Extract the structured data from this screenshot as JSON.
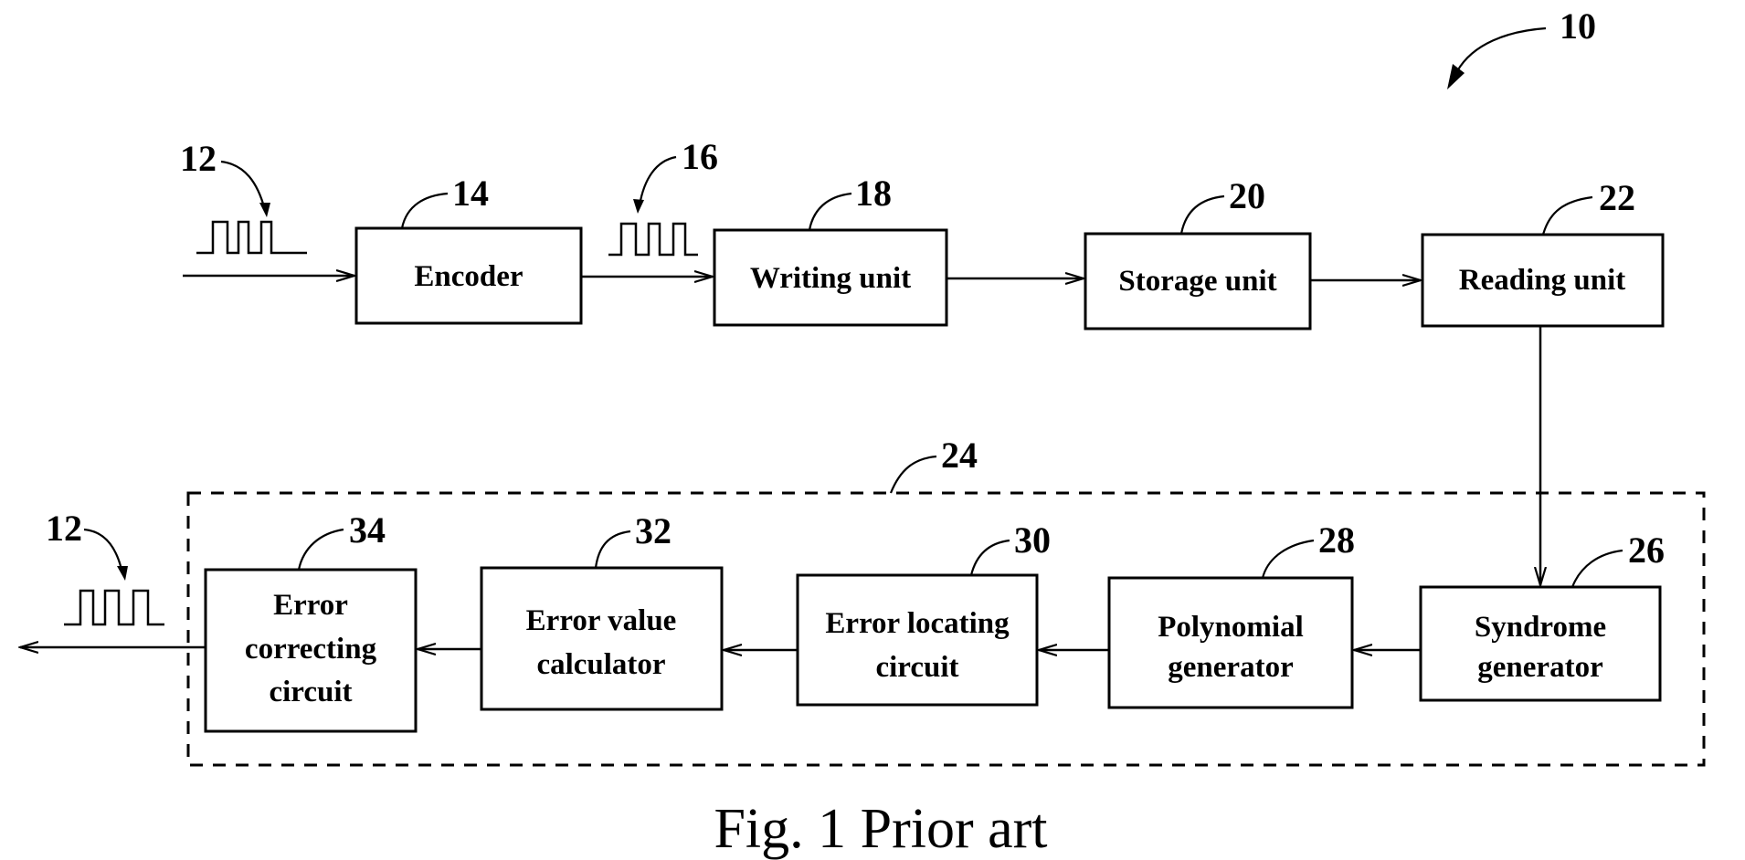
{
  "figure": {
    "caption": "Fig. 1 Prior art",
    "system_ref": "10",
    "group": {
      "ref": "24"
    },
    "blocks": [
      {
        "id": "encoder",
        "ref": "14",
        "lines": [
          "Encoder"
        ]
      },
      {
        "id": "writing-unit",
        "ref": "18",
        "lines": [
          "Writing unit"
        ]
      },
      {
        "id": "storage-unit",
        "ref": "20",
        "lines": [
          "Storage unit"
        ]
      },
      {
        "id": "reading-unit",
        "ref": "22",
        "lines": [
          "Reading unit"
        ]
      },
      {
        "id": "syndrome-generator",
        "ref": "26",
        "lines": [
          "Syndrome",
          "generator"
        ]
      },
      {
        "id": "polynomial-generator",
        "ref": "28",
        "lines": [
          "Polynomial",
          "generator"
        ]
      },
      {
        "id": "error-locating-circuit",
        "ref": "30",
        "lines": [
          "Error locating",
          "circuit"
        ]
      },
      {
        "id": "error-value-calculator",
        "ref": "32",
        "lines": [
          "Error value",
          "calculator"
        ]
      },
      {
        "id": "error-correcting-circuit",
        "ref": "34",
        "lines": [
          "Error",
          "correcting",
          "circuit"
        ]
      }
    ],
    "signals": [
      {
        "id": "input-data",
        "ref": "12"
      },
      {
        "id": "encoded-data",
        "ref": "16"
      },
      {
        "id": "output-data",
        "ref": "12"
      }
    ],
    "connections": [
      {
        "from": "input",
        "to": "encoder"
      },
      {
        "from": "encoder",
        "to": "writing-unit"
      },
      {
        "from": "writing-unit",
        "to": "storage-unit"
      },
      {
        "from": "storage-unit",
        "to": "reading-unit"
      },
      {
        "from": "reading-unit",
        "to": "syndrome-generator"
      },
      {
        "from": "syndrome-generator",
        "to": "polynomial-generator"
      },
      {
        "from": "polynomial-generator",
        "to": "error-locating-circuit"
      },
      {
        "from": "error-locating-circuit",
        "to": "error-value-calculator"
      },
      {
        "from": "error-value-calculator",
        "to": "error-correcting-circuit"
      },
      {
        "from": "error-correcting-circuit",
        "to": "output"
      }
    ]
  }
}
